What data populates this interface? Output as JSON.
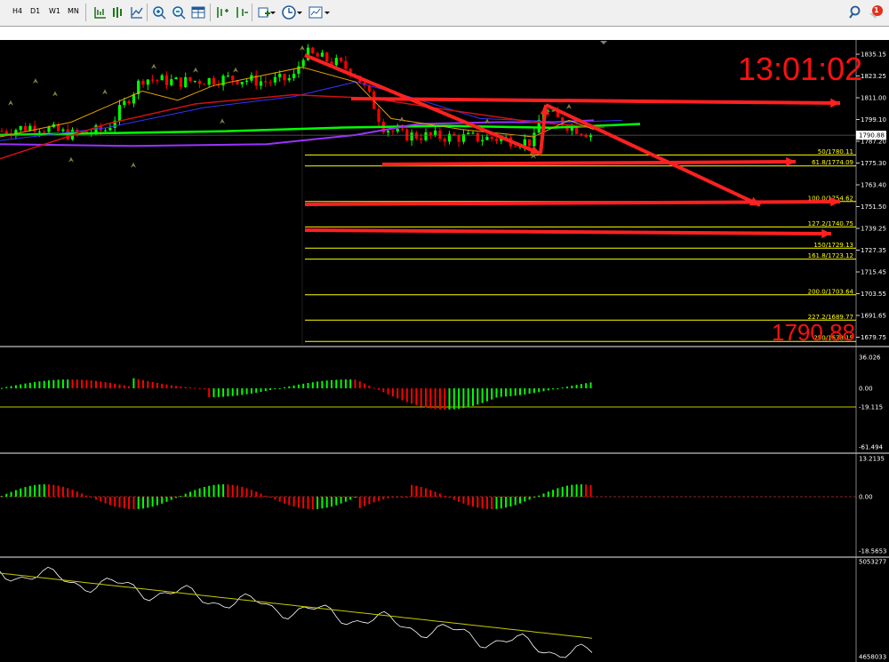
{
  "toolbar": {
    "timeframes": [
      "H4",
      "D1",
      "W1",
      "MN"
    ],
    "notification_count": "1",
    "tools": [
      "period-icon",
      "template-icon",
      "chart-type-icon",
      "zoom-in-icon",
      "zoom-out-icon",
      "tile-windows-icon",
      "shift-icon",
      "autoscroll-icon",
      "indicators-icon",
      "clock-icon",
      "objects-icon"
    ]
  },
  "clock": "13:01:02",
  "price_watermark": "1790.88",
  "current_price": "1790.88",
  "price_axis": [
    "1835.15",
    "1823.25",
    "1811.00",
    "1799.10",
    "1787.20",
    "1775.30",
    "1763.40",
    "1751.50",
    "1739.25",
    "1727.35",
    "1715.45",
    "1703.55",
    "1691.65",
    "1679.75"
  ],
  "fib_levels": [
    "50/1780.11",
    "61.8/1774.09",
    "100.0/1754.62",
    "127.2/1740.75",
    "150/1729.13",
    "161.8/1723.12",
    "200.0/1703.64",
    "227.2/1689.77",
    "250/1678.15"
  ],
  "indicator1": {
    "max": "36.026",
    "zero": "0.00",
    "level": "-19.115",
    "min": "-61.494"
  },
  "indicator2": {
    "max": "13.2135",
    "zero": "0.00",
    "min": "-18.5653"
  },
  "indicator3": {
    "max": "5053277",
    "min": "4658033"
  },
  "colors": {
    "bull": "#00ff00",
    "bear": "#ff0000",
    "fib": "#ffff00",
    "arrow": "#ff2020",
    "ma_green": "#00ff00",
    "ma_purple": "#9933ff",
    "ma_blue": "#3333ff"
  }
}
